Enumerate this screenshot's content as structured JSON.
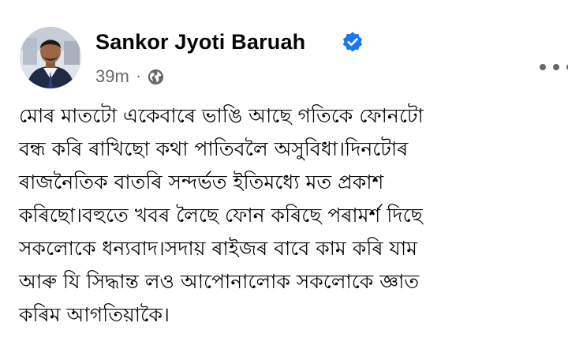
{
  "post": {
    "author": {
      "name": "Sankor Jyoti Baruah",
      "verified": true
    },
    "meta": {
      "time": "39m",
      "separator": "·",
      "audience_icon": "globe-icon"
    },
    "more_icon": "more-options-icon",
    "body_lines": [
      "মোৰ মাতটো একেবাৰে ভাঙি আছে গতিকে ফোনটো",
      "বন্ধ কৰি ৰাখিছো কথা পাতিবলৈ অসুবিধা।দিনটোৰ",
      "ৰাজনৈতিক বাতৰি সন্দৰ্ভত ইতিমধ্যে মত প্ৰকাশ",
      "কৰিছো।বহুতে খবৰ লৈছে ফোন কৰিছে পৰামৰ্শ দিছে",
      "সকলোকে ধন্যবাদ।সদায় ৰাইজৰ বাবে কাম কৰি যাম",
      "আৰু যি সিদ্ধান্ত লও আপোনালোক সকলোকে জ্ঞাত",
      "কৰিম আগতিয়াকৈ।"
    ]
  },
  "colors": {
    "verified": "#1877f2",
    "secondary_text": "#65676b",
    "primary_text": "#050505"
  }
}
